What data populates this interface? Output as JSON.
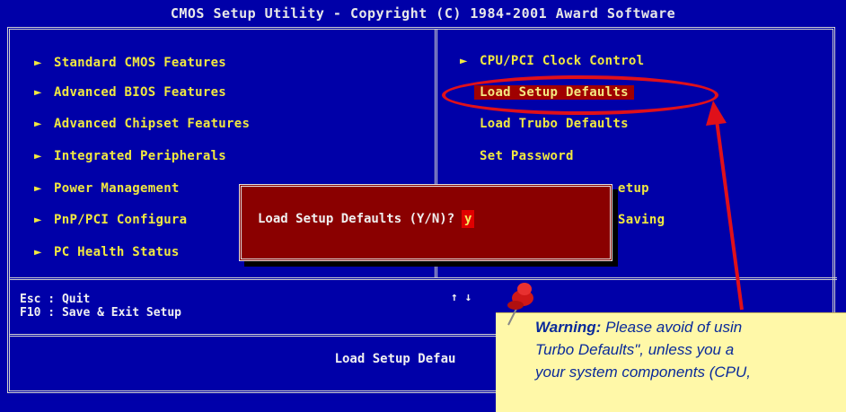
{
  "title": "CMOS Setup Utility - Copyright (C) 1984-2001 Award Software",
  "left_menu": [
    {
      "label": "Standard CMOS Features"
    },
    {
      "label": "Advanced BIOS Features"
    },
    {
      "label": "Advanced Chipset Features"
    },
    {
      "label": "Integrated Peripherals"
    },
    {
      "label": "Power Management"
    },
    {
      "label": "PnP/PCI Configura"
    },
    {
      "label": "PC Health Status"
    }
  ],
  "right_menu": [
    {
      "label": "CPU/PCI Clock Control"
    },
    {
      "label": "Load Setup Defaults"
    },
    {
      "label": "Load Trubo Defaults"
    },
    {
      "label": "Set Password"
    },
    {
      "label": "etup"
    },
    {
      "label": "Saving"
    }
  ],
  "dialog": {
    "prompt": "Load Setup Defaults (Y/N)?",
    "value": "y"
  },
  "help": {
    "line1": "Esc : Quit",
    "line2": "F10 : Save & Exit Setup",
    "arrows": "↑ ↓"
  },
  "status_bar": "Load Setup Defau",
  "note": {
    "label": "Warning:",
    "line1_rest": " Please avoid of usin",
    "line2": "Turbo Defaults\", unless you a",
    "line3": "your system components (CPU,"
  },
  "colors": {
    "bios_background": "#0000a8",
    "menu_text": "#f0e840",
    "dialog_background": "#8a0000",
    "annotation_red": "#e0101a",
    "note_background": "#fff8a8",
    "note_text": "#0a2a9a"
  }
}
